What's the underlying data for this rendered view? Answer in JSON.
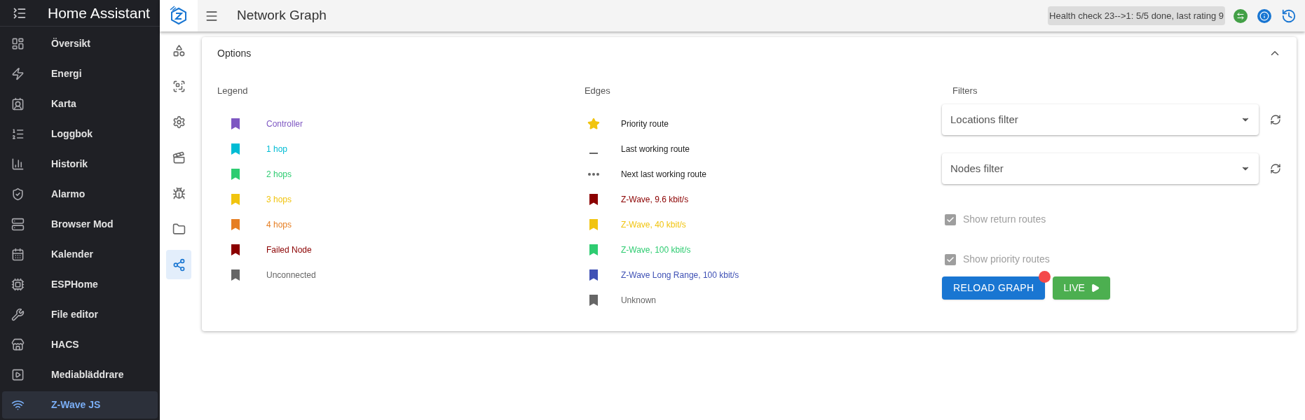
{
  "sidebar": {
    "title": "Home Assistant",
    "items": [
      {
        "label": "Översikt",
        "selected": false
      },
      {
        "label": "Energi",
        "selected": false
      },
      {
        "label": "Karta",
        "selected": false
      },
      {
        "label": "Loggbok",
        "selected": false
      },
      {
        "label": "Historik",
        "selected": false
      },
      {
        "label": "Alarmo",
        "selected": false
      },
      {
        "label": "Browser Mod",
        "selected": false
      },
      {
        "label": "Kalender",
        "selected": false
      },
      {
        "label": "ESPHome",
        "selected": false
      },
      {
        "label": "File editor",
        "selected": false
      },
      {
        "label": "HACS",
        "selected": false
      },
      {
        "label": "Mediabläddrare",
        "selected": false
      },
      {
        "label": "Z-Wave JS",
        "selected": true
      }
    ]
  },
  "rail": {
    "items": [
      {
        "selected": false
      },
      {
        "selected": false
      },
      {
        "selected": false
      },
      {
        "selected": false
      },
      {
        "selected": false
      },
      {
        "selected": false
      },
      {
        "selected": true
      }
    ]
  },
  "header": {
    "title": "Network Graph",
    "status": "Health check 23-->1: 5/5 done, last rating 9"
  },
  "options": {
    "title": "Options",
    "expanded": true,
    "legend": {
      "title": "Legend",
      "items": [
        {
          "label": "Controller",
          "color": "#7e57c2"
        },
        {
          "label": "1 hop",
          "color": "#00bcd4"
        },
        {
          "label": "2 hops",
          "color": "#2ecc71"
        },
        {
          "label": "3 hops",
          "color": "#f1c40f"
        },
        {
          "label": "4 hops",
          "color": "#e67e22"
        },
        {
          "label": "Failed Node",
          "color": "#8b0000"
        },
        {
          "label": "Unconnected",
          "color": "#666666"
        }
      ]
    },
    "edges": {
      "title": "Edges",
      "items": [
        {
          "kind": "star",
          "label": "Priority route",
          "color": "#f1c40f"
        },
        {
          "kind": "line",
          "label": "Last working route",
          "color": "#666666"
        },
        {
          "kind": "dots",
          "label": "Next last working route",
          "color": "#666666"
        },
        {
          "kind": "bookmark",
          "label": "Z-Wave, 9.6 kbit/s",
          "color": "#8b0000"
        },
        {
          "kind": "bookmark",
          "label": "Z-Wave, 40 kbit/s",
          "color": "#f1c40f"
        },
        {
          "kind": "bookmark",
          "label": "Z-Wave, 100 kbit/s",
          "color": "#2ecc71"
        },
        {
          "kind": "bookmark",
          "label": "Z-Wave Long Range, 100 kbit/s",
          "color": "#3f51b5"
        },
        {
          "kind": "bookmark",
          "label": "Unknown",
          "color": "#666666"
        }
      ]
    },
    "filters": {
      "title": "Filters",
      "selects": [
        {
          "placeholder": "Locations filter"
        },
        {
          "placeholder": "Nodes filter"
        }
      ],
      "checkboxes": [
        {
          "label": "Show return routes",
          "checked": true,
          "disabled": true
        },
        {
          "label": "Show priority routes",
          "checked": true,
          "disabled": true
        }
      ],
      "reload_button": {
        "label": "RELOAD GRAPH",
        "notification_dot": true
      },
      "live_button": {
        "label": "LIVE"
      }
    }
  }
}
